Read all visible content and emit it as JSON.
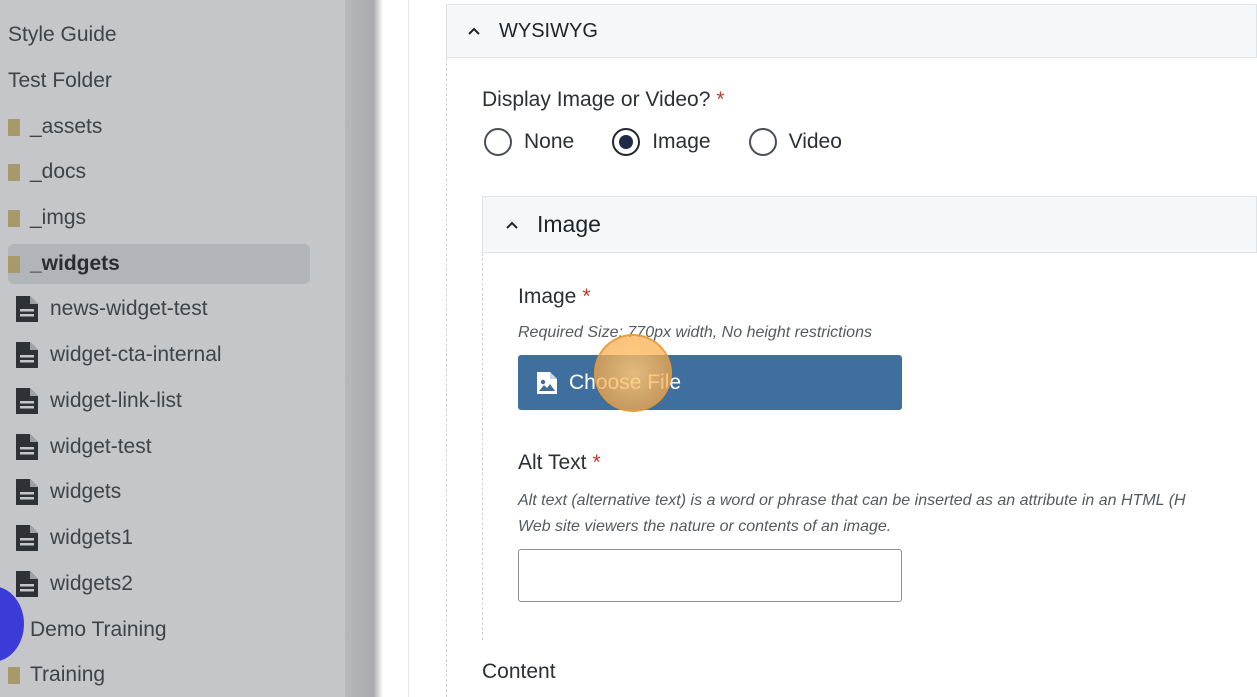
{
  "sidebar": {
    "items": [
      {
        "label": "Style Guide",
        "type": "none"
      },
      {
        "label": "Test Folder",
        "type": "none"
      },
      {
        "label": "_assets",
        "type": "folder"
      },
      {
        "label": "_docs",
        "type": "folder"
      },
      {
        "label": "_imgs",
        "type": "folder"
      },
      {
        "label": "_widgets",
        "type": "folder",
        "selected": true
      },
      {
        "label": "news-widget-test",
        "type": "file"
      },
      {
        "label": "widget-cta-internal",
        "type": "file"
      },
      {
        "label": "widget-link-list",
        "type": "file"
      },
      {
        "label": "widget-test",
        "type": "file"
      },
      {
        "label": "widgets",
        "type": "file"
      },
      {
        "label": "widgets1",
        "type": "file"
      },
      {
        "label": "widgets2",
        "type": "file"
      },
      {
        "label": "Demo Training",
        "type": "none"
      },
      {
        "label": "Training",
        "type": "folder"
      }
    ]
  },
  "wysiwyg_panel": {
    "title": "WYSIWYG",
    "display_question": "Display Image or Video?",
    "required_mark": "*",
    "options": [
      {
        "label": "None",
        "checked": false
      },
      {
        "label": "Image",
        "checked": true
      },
      {
        "label": "Video",
        "checked": false
      }
    ]
  },
  "image_panel": {
    "title": "Image",
    "image_label": "Image",
    "image_help": "Required Size: 770px width, No height restrictions",
    "choose_file_label": "Choose File",
    "alt_label": "Alt Text",
    "alt_help_line1": "Alt text (alternative text) is a word or phrase that can be inserted as an attribute in an HTML (H",
    "alt_help_line2": "Web site viewers the nature or contents of an image.",
    "alt_value": ""
  },
  "content_label": "Content",
  "icons": {
    "chevron": "chevron-up-icon",
    "folder": "folder-icon",
    "file": "file-icon",
    "choose_file": "image-file-icon"
  },
  "colors": {
    "button": "#3f6f9f",
    "required": "#c0392b",
    "sidebar_bg": "#c4c6c9"
  }
}
